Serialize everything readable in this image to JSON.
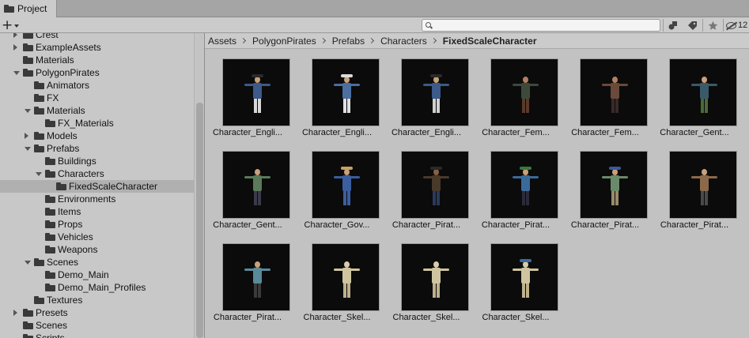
{
  "tab": {
    "label": "Project"
  },
  "toolbar": {
    "search_placeholder": "",
    "hidden_count": "12"
  },
  "tree": [
    {
      "label": "Crest",
      "depth": 1,
      "arrow": "right",
      "open": false,
      "selected": false
    },
    {
      "label": "ExampleAssets",
      "depth": 1,
      "arrow": "right",
      "open": false,
      "selected": false
    },
    {
      "label": "Materials",
      "depth": 1,
      "arrow": "none",
      "open": false,
      "selected": false
    },
    {
      "label": "PolygonPirates",
      "depth": 1,
      "arrow": "down",
      "open": true,
      "selected": false
    },
    {
      "label": "Animators",
      "depth": 2,
      "arrow": "none",
      "open": false,
      "selected": false
    },
    {
      "label": "FX",
      "depth": 2,
      "arrow": "none",
      "open": false,
      "selected": false
    },
    {
      "label": "Materials",
      "depth": 2,
      "arrow": "down",
      "open": true,
      "selected": false
    },
    {
      "label": "FX_Materials",
      "depth": 3,
      "arrow": "none",
      "open": false,
      "selected": false
    },
    {
      "label": "Models",
      "depth": 2,
      "arrow": "right",
      "open": false,
      "selected": false
    },
    {
      "label": "Prefabs",
      "depth": 2,
      "arrow": "down",
      "open": true,
      "selected": false
    },
    {
      "label": "Buildings",
      "depth": 3,
      "arrow": "none",
      "open": false,
      "selected": false
    },
    {
      "label": "Characters",
      "depth": 3,
      "arrow": "down",
      "open": true,
      "selected": false
    },
    {
      "label": "FixedScaleCharacter",
      "depth": 4,
      "arrow": "none",
      "open": false,
      "selected": true
    },
    {
      "label": "Environments",
      "depth": 3,
      "arrow": "none",
      "open": false,
      "selected": false
    },
    {
      "label": "Items",
      "depth": 3,
      "arrow": "none",
      "open": false,
      "selected": false
    },
    {
      "label": "Props",
      "depth": 3,
      "arrow": "none",
      "open": false,
      "selected": false
    },
    {
      "label": "Vehicles",
      "depth": 3,
      "arrow": "none",
      "open": false,
      "selected": false
    },
    {
      "label": "Weapons",
      "depth": 3,
      "arrow": "none",
      "open": false,
      "selected": false
    },
    {
      "label": "Scenes",
      "depth": 2,
      "arrow": "down",
      "open": true,
      "selected": false
    },
    {
      "label": "Demo_Main",
      "depth": 3,
      "arrow": "none",
      "open": false,
      "selected": false
    },
    {
      "label": "Demo_Main_Profiles",
      "depth": 3,
      "arrow": "none",
      "open": false,
      "selected": false
    },
    {
      "label": "Textures",
      "depth": 2,
      "arrow": "none",
      "open": false,
      "selected": false
    },
    {
      "label": "Presets",
      "depth": 1,
      "arrow": "right",
      "open": false,
      "selected": false
    },
    {
      "label": "Scenes",
      "depth": 1,
      "arrow": "none",
      "open": false,
      "selected": false
    },
    {
      "label": "Scripts",
      "depth": 1,
      "arrow": "none",
      "open": false,
      "selected": false
    }
  ],
  "breadcrumb": [
    "Assets",
    "PolygonPirates",
    "Prefabs",
    "Characters",
    "FixedScaleCharacter"
  ],
  "assets": [
    {
      "label": "Character_Engli...",
      "colors": {
        "coat": "#3c5a8a",
        "pants": "#d8d8d8",
        "head": "#c9a07a",
        "hat": "#2a2a2a"
      }
    },
    {
      "label": "Character_Engli...",
      "colors": {
        "coat": "#4a6fa0",
        "pants": "#e0e0e0",
        "head": "#c9a07a",
        "hat": "#dcdcdc"
      }
    },
    {
      "label": "Character_Engli...",
      "colors": {
        "coat": "#3c5a8a",
        "pants": "#d0d0d0",
        "head": "#c9a07a",
        "hat": "#2a2a2a"
      }
    },
    {
      "label": "Character_Fem...",
      "colors": {
        "coat": "#3d4a3a",
        "pants": "#5a3a2a",
        "head": "#b08060",
        "hat": ""
      }
    },
    {
      "label": "Character_Fem...",
      "colors": {
        "coat": "#6a4a3a",
        "pants": "#3a2a2a",
        "head": "#b08060",
        "hat": ""
      }
    },
    {
      "label": "Character_Gent...",
      "colors": {
        "coat": "#3a5a6a",
        "pants": "#4a6a3a",
        "head": "#c9a07a",
        "hat": ""
      }
    },
    {
      "label": "Character_Gent...",
      "colors": {
        "coat": "#5a7a5a",
        "pants": "#3a3a4a",
        "head": "#c9a07a",
        "hat": ""
      }
    },
    {
      "label": "Character_Gov...",
      "colors": {
        "coat": "#3a5ea0",
        "pants": "#3a5ea0",
        "head": "#c9a07a",
        "hat": "#c8a060"
      }
    },
    {
      "label": "Character_Pirat...",
      "colors": {
        "coat": "#4a3a2a",
        "pants": "#2a3a5a",
        "head": "#8a6040",
        "hat": "#2a2a2a"
      }
    },
    {
      "label": "Character_Pirat...",
      "colors": {
        "coat": "#3a6a9a",
        "pants": "#2a2a3a",
        "head": "#c9a07a",
        "hat": "#3a7a3a"
      }
    },
    {
      "label": "Character_Pirat...",
      "colors": {
        "coat": "#6a8a6a",
        "pants": "#9a8a6a",
        "head": "#c9a07a",
        "hat": "#3a5a9a"
      }
    },
    {
      "label": "Character_Pirat...",
      "colors": {
        "coat": "#8a6a4a",
        "pants": "#4a4a4a",
        "head": "#c9a07a",
        "hat": ""
      }
    },
    {
      "label": "Character_Pirat...",
      "colors": {
        "coat": "#5a8a9a",
        "pants": "#3a3a3a",
        "head": "#c9a07a",
        "hat": ""
      }
    },
    {
      "label": "Character_Skel...",
      "colors": {
        "coat": "#cfc4a0",
        "pants": "#bdb08a",
        "head": "#d8ccaa",
        "hat": ""
      }
    },
    {
      "label": "Character_Skel...",
      "colors": {
        "coat": "#cfc4a0",
        "pants": "#bdb08a",
        "head": "#d8ccaa",
        "hat": ""
      }
    },
    {
      "label": "Character_Skel...",
      "colors": {
        "coat": "#cfc4a0",
        "pants": "#bdb08a",
        "head": "#d8ccaa",
        "hat": "#3a6aa0"
      }
    }
  ]
}
